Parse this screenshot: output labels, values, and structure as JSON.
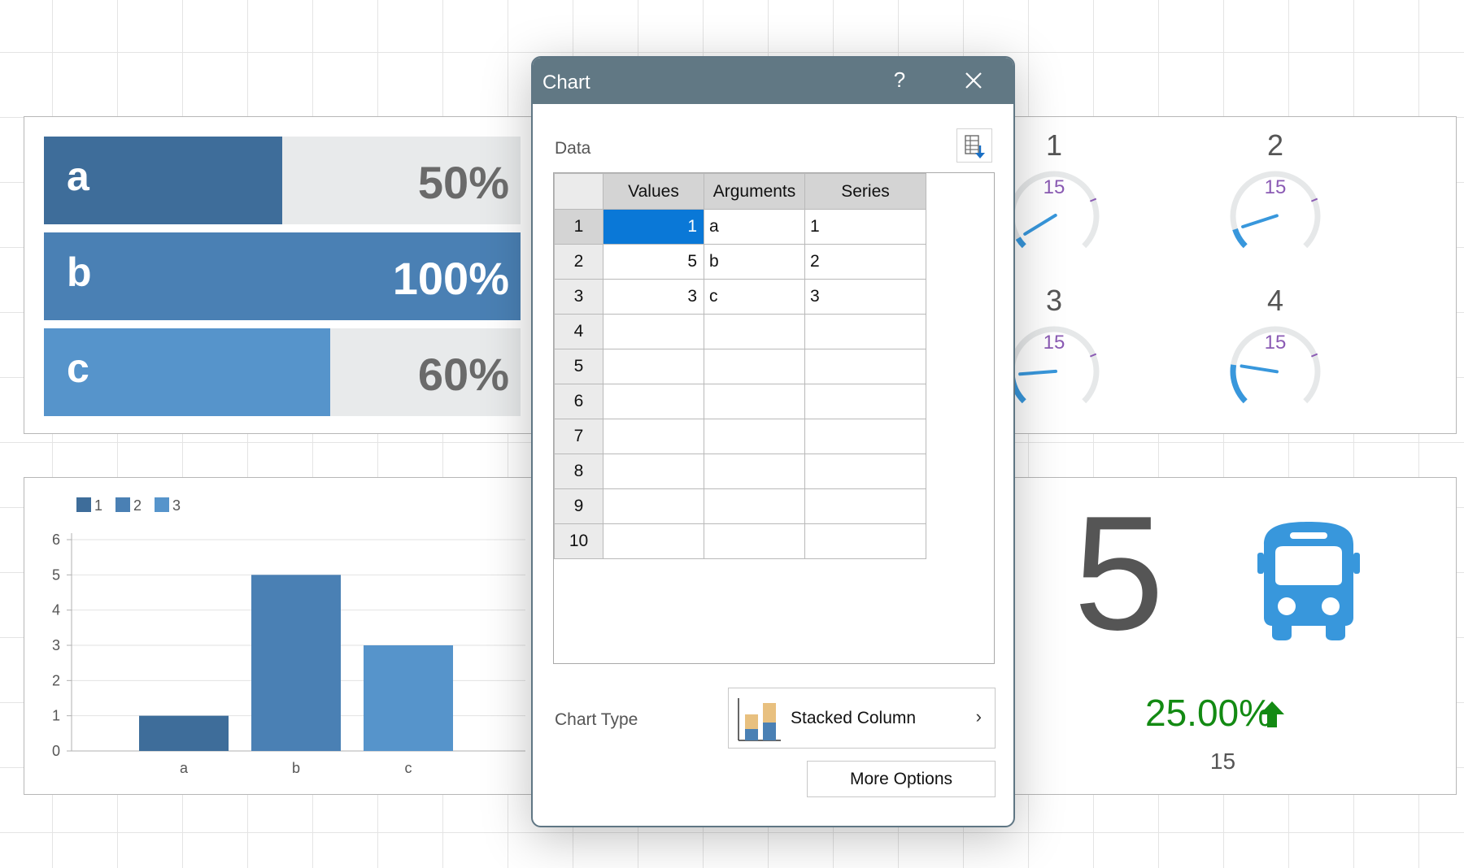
{
  "colors": {
    "bar_a": "#3e6d9a",
    "bar_b": "#4a80b4",
    "bar_c": "#5694cb",
    "gauge_accent": "#3897dc",
    "gauge_track": "#e6e8e9",
    "gauge_target": "#8b5bb4",
    "kpi_up": "#138a13",
    "selection": "#0a78d7"
  },
  "progress_bars": [
    {
      "label": "a",
      "percent_text": "50%",
      "fraction": 0.5
    },
    {
      "label": "b",
      "percent_text": "100%",
      "fraction": 1.0
    },
    {
      "label": "c",
      "percent_text": "60%",
      "fraction": 0.6
    }
  ],
  "gauges": [
    {
      "title": "1",
      "value": 1,
      "target_label": "15",
      "target": 15
    },
    {
      "title": "2",
      "value": 2,
      "target_label": "15",
      "target": 15
    },
    {
      "title": "3",
      "value": 3,
      "target_label": "15",
      "target": 15
    },
    {
      "title": "4",
      "value": 4,
      "target_label": "15",
      "target": 15
    }
  ],
  "chart_data": {
    "type": "bar",
    "categories": [
      "a",
      "b",
      "c"
    ],
    "series": [
      {
        "name": "1",
        "values": [
          1,
          null,
          null
        ]
      },
      {
        "name": "2",
        "values": [
          null,
          5,
          null
        ]
      },
      {
        "name": "3",
        "values": [
          null,
          null,
          3
        ]
      }
    ],
    "ylim": [
      0,
      6
    ],
    "yticks": [
      0,
      1,
      2,
      3,
      4,
      5,
      6
    ],
    "legend": "top-left",
    "grid": true
  },
  "kpi": {
    "value": "5",
    "delta_text": "25.00%",
    "target_text": "15",
    "icon": "bus-icon",
    "trend_icon": "arrow-up-icon"
  },
  "dialog": {
    "title": "Chart",
    "help_label": "?",
    "close_icon": "close-icon",
    "data_label": "Data",
    "import_icon": "import-data-icon",
    "columns": [
      "Values",
      "Arguments",
      "Series"
    ],
    "rows": [
      {
        "num": "1",
        "values": "1",
        "arguments": "a",
        "series": "1"
      },
      {
        "num": "2",
        "values": "5",
        "arguments": "b",
        "series": "2"
      },
      {
        "num": "3",
        "values": "3",
        "arguments": "c",
        "series": "3"
      },
      {
        "num": "4",
        "values": "",
        "arguments": "",
        "series": ""
      },
      {
        "num": "5",
        "values": "",
        "arguments": "",
        "series": ""
      },
      {
        "num": "6",
        "values": "",
        "arguments": "",
        "series": ""
      },
      {
        "num": "7",
        "values": "",
        "arguments": "",
        "series": ""
      },
      {
        "num": "8",
        "values": "",
        "arguments": "",
        "series": ""
      },
      {
        "num": "9",
        "values": "",
        "arguments": "",
        "series": ""
      },
      {
        "num": "10",
        "values": "",
        "arguments": "",
        "series": ""
      }
    ],
    "chart_type_label": "Chart Type",
    "chart_type_value": "Stacked Column",
    "chart_type_icon": "stacked-column-icon",
    "chart_type_chevron": "›",
    "more_options_label": "More Options"
  }
}
